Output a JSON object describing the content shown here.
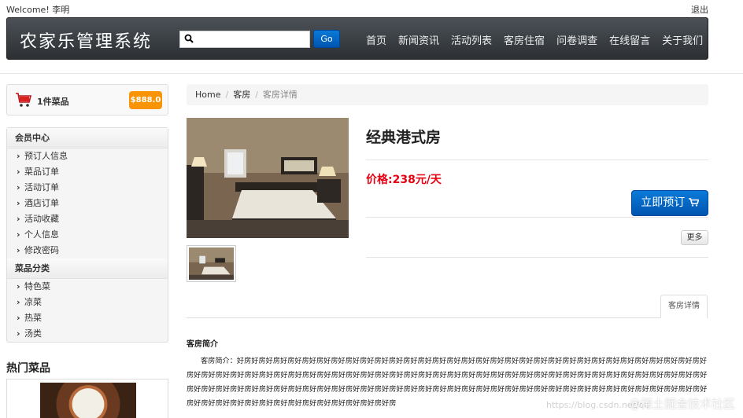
{
  "topbar": {
    "welcome": "Welcome! 李明",
    "logout": "退出"
  },
  "header": {
    "brand": "农家乐管理系统",
    "search_value": "",
    "go_label": "Go",
    "nav": [
      "首页",
      "新闻资讯",
      "活动列表",
      "客房住宿",
      "问卷调查",
      "在线留言",
      "关于我们"
    ]
  },
  "cart": {
    "count_label": "1件菜品",
    "amount": "$888.0"
  },
  "sidebar": {
    "member_title": "会员中心",
    "member_items": [
      "预订人信息",
      "菜品订单",
      "活动订单",
      "酒店订单",
      "活动收藏",
      "个人信息",
      "修改密码"
    ],
    "dish_title": "菜品分类",
    "dish_items": [
      "特色菜",
      "凉菜",
      "热菜",
      "汤类"
    ]
  },
  "hot": {
    "title": "热门菜品"
  },
  "breadcrumb": {
    "home": "Home",
    "level1": "客房",
    "current": "客房详情"
  },
  "room": {
    "title": "经典港式房",
    "price": "价格:238元/天",
    "book_label": "立即预订",
    "more_label": "更多",
    "tab_label": "客房详情",
    "intro_heading": "客房简介",
    "intro_text": "客房简介：好房好房好房好房好房好房好房好房好房好房好房好房好房好房好房好房好房好房好房好房好房好房好房好房好房好房好房好房好房好房好房好房好房好房好房好房好房好房好房好房好房好房好房好房好房好房好房好房好房好房好房好房好房好房好房好房好房好房好房好房好房好房好房好房好房好房好房好房好房好房好房好房好房好房好房好房好房好房好房好房好房好房好房好房好房好房好房好房好房好房好房好房好房好房好房好房好房好房好房好房好房好房好房好房好房好房好房好房好房好房好房好房好房好房好房好房好房好房好房"
  },
  "watermark": {
    "main": "@稀土掘金技术社区",
    "sub": "https://blog.csdn.net/qq"
  },
  "colors": {
    "accent_blue": "#0055b0",
    "price_red": "#e60012",
    "badge_orange": "#f89406"
  }
}
